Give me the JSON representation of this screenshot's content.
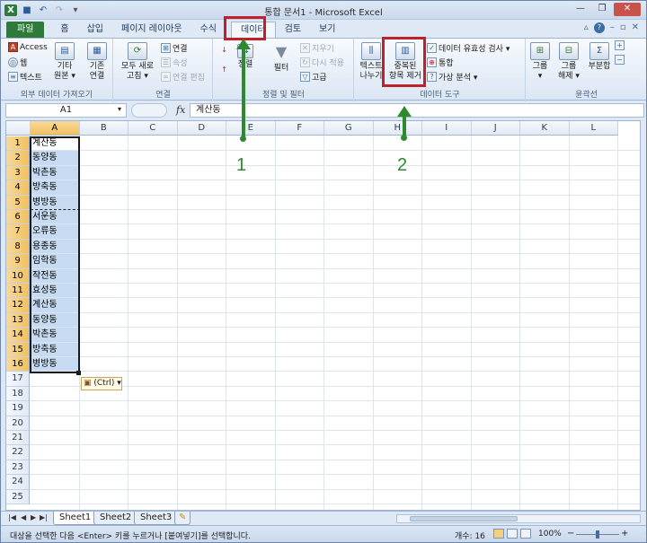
{
  "window": {
    "title": "통합 문서1  -  Microsoft Excel",
    "controls": [
      "—",
      "❐",
      "✕"
    ]
  },
  "tabs": {
    "file": "파일",
    "items": [
      "홈",
      "삽입",
      "페이지 레이아웃",
      "수식",
      "데이터",
      "검토",
      "보기"
    ],
    "active": "데이터"
  },
  "ribbon": {
    "external": {
      "access": "Access",
      "web": "웹",
      "text": "텍스트",
      "other_line1": "기타",
      "other_line2": "원본 ▾",
      "existing_line1": "기존",
      "existing_line2": "연결",
      "label": "외부 데이터 가져오기"
    },
    "connections": {
      "refresh_line1": "모두 새로",
      "refresh_line2": "고침 ▾",
      "conn": "연결",
      "props": "속성",
      "edit_links": "연결 편집",
      "label": "연결"
    },
    "sort": {
      "sort": "정렬",
      "filter": "필터",
      "clear": "지우기",
      "reapply": "다시 적용",
      "advanced": "고급",
      "label": "정렬 및 필터"
    },
    "tools": {
      "text_cols_line1": "텍스트",
      "text_cols_line2": "나누기",
      "remove_dup_line1": "중복된",
      "remove_dup_line2": "항목 제거",
      "validation": "데이터 유효성 검사 ▾",
      "consolidate": "통합",
      "whatif": "가상 분석 ▾",
      "label": "데이터 도구"
    },
    "outline": {
      "group_line1": "그룹",
      "group_line2": "▾",
      "ungroup_line1": "그룹",
      "ungroup_line2": "해제 ▾",
      "subtotal": "부분합",
      "label": "윤곽선"
    }
  },
  "formula_bar": {
    "name_box": "A1",
    "fx": "fx",
    "value": "계산동"
  },
  "columns": [
    "A",
    "B",
    "C",
    "D",
    "E",
    "F",
    "G",
    "H",
    "I",
    "J",
    "K",
    "L"
  ],
  "rows": [
    "1",
    "2",
    "3",
    "4",
    "5",
    "6",
    "7",
    "8",
    "9",
    "10",
    "11",
    "12",
    "13",
    "14",
    "15",
    "16",
    "17",
    "18",
    "19",
    "20",
    "21",
    "22",
    "23",
    "24",
    "25"
  ],
  "cells_a": [
    "계산동",
    "동양동",
    "박촌동",
    "방축동",
    "병방동",
    "서운동",
    "오류동",
    "용종동",
    "임학동",
    "작전동",
    "효성동",
    "계산동",
    "동양동",
    "박촌동",
    "방축동",
    "병방동"
  ],
  "paste_options": "(Ctrl) ▾",
  "annotations": {
    "n1": "1",
    "n2": "2"
  },
  "sheets": [
    "Sheet1",
    "Sheet2",
    "Sheet3"
  ],
  "status": {
    "message": "대상을 선택한 다음 <Enter> 키를 누르거나 [붙여넣기]를 선택합니다.",
    "count": "개수: 16",
    "zoom": "100%"
  }
}
